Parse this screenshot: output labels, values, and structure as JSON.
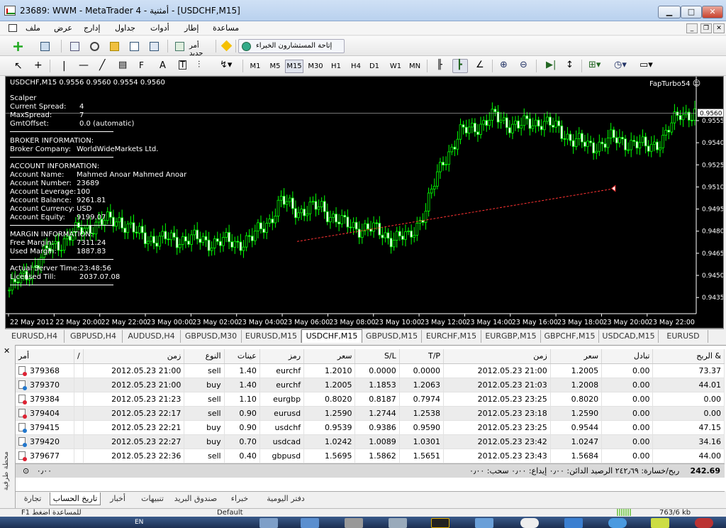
{
  "window": {
    "title": "23689: WWM - MetaTrader 4 - أمثنية - [USDCHF,M15]"
  },
  "menu": [
    "ملف",
    "عرض",
    "إدارج",
    "جداول",
    "أدوات",
    "إطار",
    "مساعدة"
  ],
  "toolbar": {
    "new_order_label": "أمر جديد",
    "experts_label": "إتاحة المستشارون الخبراء",
    "timeframes": [
      "M1",
      "M5",
      "M15",
      "M30",
      "H1",
      "H4",
      "D1",
      "W1",
      "MN"
    ],
    "active_timeframe": "M15"
  },
  "chart": {
    "header": "USDCHF,M15  0.9556 0.9560 0.9554 0.9560",
    "expert": "FapTurbo54",
    "price_label": "0.9560"
  },
  "info": [
    {
      "k": "Scalper",
      "v": ""
    },
    {
      "k": "Current Spread:",
      "v": "4"
    },
    {
      "k": "MaxSpread:",
      "v": "7"
    },
    {
      "k": "GmtOffset:",
      "v": "0.0 (automatic)"
    },
    {
      "sep": true
    },
    {
      "k": "BROKER INFORMATION:",
      "v": ""
    },
    {
      "k": "Broker Company:",
      "v": "WorldWideMarkets Ltd."
    },
    {
      "sep": true
    },
    {
      "k": "ACCOUNT INFORMATION:",
      "v": ""
    },
    {
      "k": "Account Name:",
      "v": "Mahmed Anoar Mahmed Anoar"
    },
    {
      "k": "Account Number:",
      "v": "23689"
    },
    {
      "k": "Account Leverage:",
      "v": "100"
    },
    {
      "k": "Account Balance:",
      "v": "9261.81"
    },
    {
      "k": "Account Currency:",
      "v": "USD"
    },
    {
      "k": "Account Equity:",
      "v": "9199.07"
    },
    {
      "sep": true
    },
    {
      "k": "MARGIN INFORMATION:",
      "v": ""
    },
    {
      "k": "Free Margin:",
      "v": "7311.24"
    },
    {
      "k": "Used Margin:",
      "v": "1887.83"
    },
    {
      "sep": true
    },
    {
      "k": "Actual Server Time:",
      "v": "23:48:56"
    },
    {
      "k": "Licensed Till:",
      "v": "2037.07.08"
    },
    {
      "sep": true
    }
  ],
  "chart_data": {
    "type": "candlestick",
    "symbol": "USDCHF",
    "timeframe": "M15",
    "title": "USDCHF,M15",
    "ylim": [
      0.9425,
      0.958
    ],
    "y_ticks": [
      "0.9555",
      "0.9540",
      "0.9525",
      "0.9510",
      "0.9495",
      "0.9480",
      "0.9465",
      "0.9450",
      "0.9435"
    ],
    "y_tick_values": [
      0.9555,
      0.954,
      0.9525,
      0.951,
      0.9495,
      0.948,
      0.9465,
      0.945,
      0.9435
    ],
    "x_ticks": [
      "22 May 2012",
      "22 May 20:00",
      "22 May 22:00",
      "23 May 00:00",
      "23 May 02:00",
      "23 May 04:00",
      "23 May 06:00",
      "23 May 08:00",
      "23 May 10:00",
      "23 May 12:00",
      "23 May 14:00",
      "23 May 16:00",
      "23 May 18:00",
      "23 May 20:00",
      "23 May 22:00"
    ],
    "close_anchors": [
      [
        0,
        0.944
      ],
      [
        8,
        0.9455
      ],
      [
        14,
        0.9468
      ],
      [
        22,
        0.9478
      ],
      [
        30,
        0.9485
      ],
      [
        38,
        0.9488
      ],
      [
        44,
        0.9478
      ],
      [
        52,
        0.9474
      ],
      [
        60,
        0.9475
      ],
      [
        70,
        0.9473
      ],
      [
        78,
        0.9472
      ],
      [
        84,
        0.9475
      ],
      [
        90,
        0.9488
      ],
      [
        94,
        0.95
      ],
      [
        100,
        0.9494
      ],
      [
        108,
        0.9496
      ],
      [
        116,
        0.9484
      ],
      [
        124,
        0.9482
      ],
      [
        132,
        0.9476
      ],
      [
        138,
        0.9475
      ],
      [
        144,
        0.9495
      ],
      [
        150,
        0.9528
      ],
      [
        156,
        0.9546
      ],
      [
        162,
        0.9552
      ],
      [
        168,
        0.9557
      ],
      [
        176,
        0.9551
      ],
      [
        184,
        0.9555
      ],
      [
        192,
        0.9546
      ],
      [
        200,
        0.9537
      ],
      [
        208,
        0.9542
      ],
      [
        216,
        0.954
      ],
      [
        220,
        0.9536
      ],
      [
        226,
        0.9543
      ],
      [
        232,
        0.956
      ]
    ],
    "bid_price": 0.956,
    "trade_lines": [
      [
        [
          100,
          0.9473
        ],
        [
          210,
          0.9509
        ]
      ],
      [
        [
          380,
          0.954
        ],
        [
          392,
          0.9541
        ]
      ]
    ]
  },
  "chart_tabs": [
    "EURUSD,H4",
    "GBPUSD,H4",
    "AUDUSD,H4",
    "GBPUSD,M30",
    "EURUSD,M15",
    "USDCHF,M15",
    "GBPUSD,M15",
    "EURCHF,M15",
    "EURGBP,M15",
    "GBPCHF,M15",
    "USDCAD,M15",
    "EURUSD"
  ],
  "active_chart_tab": 5,
  "terminal": {
    "columns": [
      "أمر",
      "/",
      "زمن",
      "النوع",
      "عينات",
      "رمز",
      "سعر",
      "S/L",
      "T/P",
      "زمن",
      "سعر",
      "تبادل",
      "الربح &"
    ],
    "rows": [
      [
        "379368",
        "2012.05.23 21:00",
        "sell",
        "1.40",
        "eurchf",
        "1.2010",
        "0.0000",
        "0.0000",
        "2012.05.23 21:00",
        "1.2005",
        "0.00",
        "73.37"
      ],
      [
        "379370",
        "2012.05.23 21:00",
        "buy",
        "1.40",
        "eurchf",
        "1.2005",
        "1.1853",
        "1.2063",
        "2012.05.23 21:03",
        "1.2008",
        "0.00",
        "44.01"
      ],
      [
        "379384",
        "2012.05.23 21:23",
        "sell",
        "1.10",
        "eurgbp",
        "0.8020",
        "0.8187",
        "0.7974",
        "2012.05.23 23:25",
        "0.8020",
        "0.00",
        "0.00"
      ],
      [
        "379404",
        "2012.05.23 22:17",
        "sell",
        "0.90",
        "eurusd",
        "1.2590",
        "1.2744",
        "1.2538",
        "2012.05.23 23:18",
        "1.2590",
        "0.00",
        "0.00"
      ],
      [
        "379415",
        "2012.05.23 22:21",
        "buy",
        "0.90",
        "usdchf",
        "0.9539",
        "0.9386",
        "0.9590",
        "2012.05.23 23:25",
        "0.9544",
        "0.00",
        "47.15"
      ],
      [
        "379420",
        "2012.05.23 22:27",
        "buy",
        "0.70",
        "usdcad",
        "1.0242",
        "1.0089",
        "1.0301",
        "2012.05.23 23:42",
        "1.0247",
        "0.00",
        "34.16"
      ],
      [
        "379677",
        "2012.05.23 22:36",
        "sell",
        "0.40",
        "gbpusd",
        "1.5695",
        "1.5862",
        "1.5651",
        "2012.05.23 23:43",
        "1.5684",
        "0.00",
        "44.00"
      ]
    ],
    "summary": "ربح/خسارة: ٢٤٢٫٦٩  الرصيد الدائن: ٠٫٠٠  إيداع: ٠٫٠٠  سحب: ٠٫٠٠",
    "summary_left": "٠٫٠٠",
    "total": "242.69",
    "tabs": [
      "تجارة",
      "تاريخ الحساب",
      "أخبار",
      "تنبيهات",
      "صندوق البريد",
      "خبراء",
      "دفتر اليومية"
    ],
    "active_tab": 1,
    "side_label": "محطة طرفية"
  },
  "status": {
    "help": "F1 للمساعدة اضغط",
    "profile": "Default",
    "traffic": "763/6 kb"
  },
  "taskbar": {
    "lang": "EN"
  },
  "colors": {
    "chart_bg": "#000000",
    "candle": "#00ff00",
    "grid": "#ffffff",
    "trade_line": "#ff0000"
  }
}
